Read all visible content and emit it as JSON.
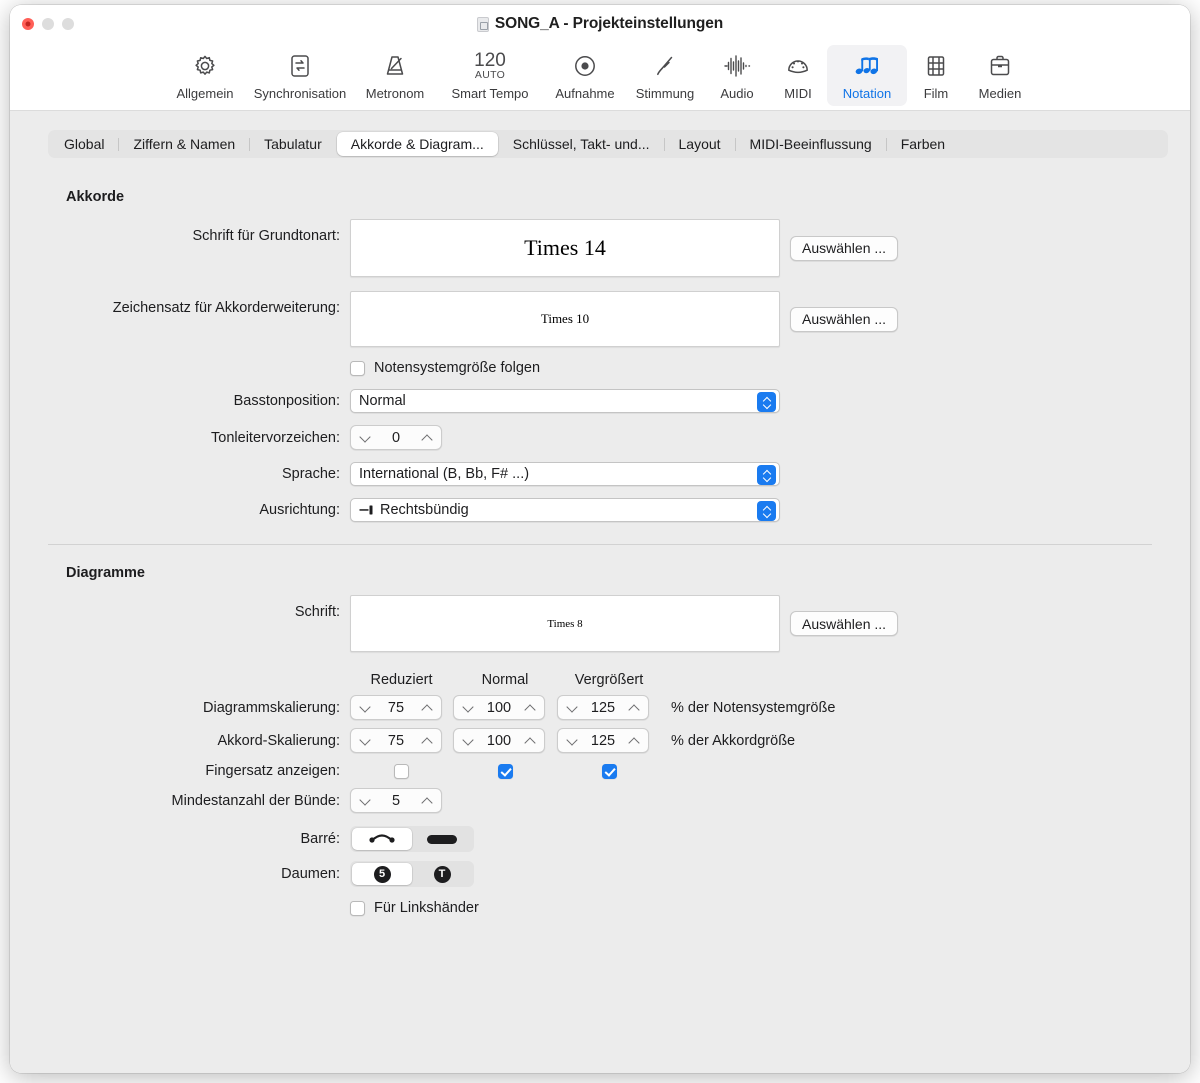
{
  "window": {
    "title": "SONG_A - Projekteinstellungen",
    "doc_icon": "document-icon",
    "accent_color": "#1a7bf0",
    "background_color": "#ececec"
  },
  "toolbar": {
    "items": [
      {
        "label": "Allgemein",
        "icon": "gear-icon",
        "active": false
      },
      {
        "label": "Synchronisation",
        "icon": "sync-icon",
        "active": false
      },
      {
        "label": "Metronom",
        "icon": "metronome-icon",
        "active": false
      },
      {
        "label": "Smart Tempo",
        "icon": "tempo-icon",
        "active": false,
        "tempo_value": "120",
        "tempo_mode": "AUTO"
      },
      {
        "label": "Aufnahme",
        "icon": "record-icon",
        "active": false
      },
      {
        "label": "Stimmung",
        "icon": "tuning-fork-icon",
        "active": false
      },
      {
        "label": "Audio",
        "icon": "waveform-icon",
        "active": false
      },
      {
        "label": "MIDI",
        "icon": "midi-port-icon",
        "active": false
      },
      {
        "label": "Notation",
        "icon": "music-notes-icon",
        "active": true
      },
      {
        "label": "Film",
        "icon": "film-strip-icon",
        "active": false
      },
      {
        "label": "Medien",
        "icon": "briefcase-icon",
        "active": false
      }
    ]
  },
  "tabs": [
    {
      "label": "Global",
      "selected": false
    },
    {
      "label": "Ziffern & Namen",
      "selected": false
    },
    {
      "label": "Tabulatur",
      "selected": false
    },
    {
      "label": "Akkorde & Diagram...",
      "selected": true
    },
    {
      "label": "Schlüssel, Takt- und...",
      "selected": false
    },
    {
      "label": "Layout",
      "selected": false
    },
    {
      "label": "MIDI-Beeinflussung",
      "selected": false
    },
    {
      "label": "Farben",
      "selected": false
    }
  ],
  "akkorde": {
    "section_title": "Akkorde",
    "schrift_grundtonart": {
      "label": "Schrift für Grundtonart:",
      "value": "Times 14",
      "button": "Auswählen ..."
    },
    "zeichensatz_erweiterung": {
      "label": "Zeichensatz für Akkorderweiterung:",
      "value": "Times 10",
      "button": "Auswählen ..."
    },
    "notensystemgroesse": {
      "label": "Notensystemgröße folgen",
      "checked": false
    },
    "basstonposition": {
      "label": "Basstonposition:",
      "value": "Normal"
    },
    "tonleitervorzeichen": {
      "label": "Tonleitervorzeichen:",
      "value": "0"
    },
    "sprache": {
      "label": "Sprache:",
      "value": "International (B, Bb, F# ...)"
    },
    "ausrichtung": {
      "label": "Ausrichtung:",
      "value": "Rechtsbündig",
      "icon": "align-right-icon"
    }
  },
  "diagramme": {
    "section_title": "Diagramme",
    "schrift": {
      "label": "Schrift:",
      "value": "Times 8",
      "button": "Auswählen ..."
    },
    "columns": [
      "Reduziert",
      "Normal",
      "Vergrößert"
    ],
    "diagrammskalierung": {
      "label": "Diagrammskalierung:",
      "values": [
        "75",
        "100",
        "125"
      ],
      "suffix": "% der Notensystemgröße"
    },
    "akkord_skalierung": {
      "label": "Akkord-Skalierung:",
      "values": [
        "75",
        "100",
        "125"
      ],
      "suffix": "% der Akkordgröße"
    },
    "fingersatz": {
      "label": "Fingersatz anzeigen:",
      "checked": [
        false,
        true,
        true
      ]
    },
    "mindestanzahl_buende": {
      "label": "Mindestanzahl der Bünde:",
      "value": "5"
    },
    "barre": {
      "label": "Barré:",
      "options": [
        "barre-arc-icon",
        "barre-bar-icon"
      ],
      "selected_index": 0
    },
    "daumen": {
      "label": "Daumen:",
      "options": [
        "5",
        "T"
      ],
      "selected_index": 0
    },
    "linkshaender": {
      "label": "Für Linkshänder",
      "checked": false
    }
  }
}
